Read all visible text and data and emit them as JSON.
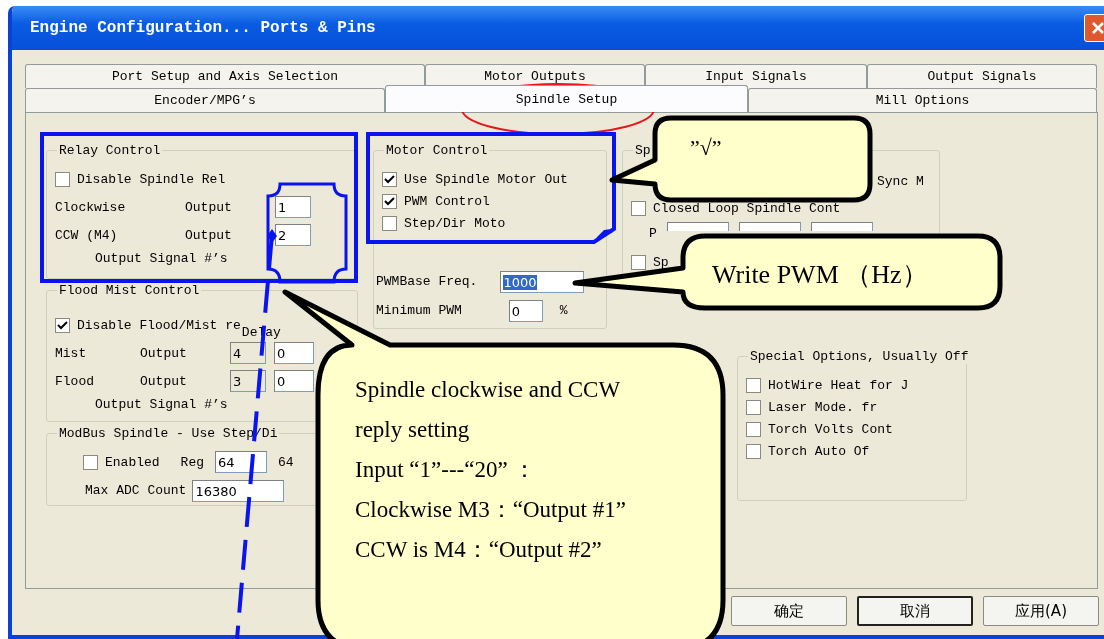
{
  "window": {
    "title": "Engine Configuration... Ports & Pins"
  },
  "tab_rows": [
    [
      {
        "label": "Port Setup and Axis Selection",
        "selected": false
      },
      {
        "label": "Motor Outputs",
        "selected": false
      },
      {
        "label": "Input Signals",
        "selected": false
      },
      {
        "label": "Output Signals",
        "selected": false
      }
    ],
    [
      {
        "label": "Encoder/MPG’s",
        "selected": false
      },
      {
        "label": "Spindle Setup",
        "selected": true
      },
      {
        "label": "Mill Options",
        "selected": false
      }
    ]
  ],
  "relay_control": {
    "title": "Relay Control",
    "disable": {
      "label": "Disable Spindle Rel",
      "checked": false
    },
    "outputs": [
      {
        "name": "Clockwise",
        "label": "Output",
        "value": "1"
      },
      {
        "name": "CCW (M4)",
        "label": "Output",
        "value": "2"
      }
    ],
    "footer": "Output Signal #’s"
  },
  "flood_mist_control": {
    "title": "Flood Mist Control",
    "disable": {
      "label": "Disable Flood/Mist re",
      "checked": true
    },
    "delay_label": "Delay",
    "outputs": [
      {
        "name": "Mist",
        "label": "Output",
        "value": "4",
        "delay": "0"
      },
      {
        "name": "Flood",
        "label": "Output",
        "value": "3",
        "delay": "0"
      }
    ],
    "footer": "Output Signal #’s"
  },
  "modbus_spindle": {
    "title": "ModBus Spindle - Use Step/Di",
    "enabled": {
      "label": "Enabled",
      "checked": false
    },
    "reg_label": "Reg",
    "reg_value": "64",
    "reg_text": "64",
    "max_adc_label": "Max ADC Count",
    "max_adc_value": "16380"
  },
  "motor_control": {
    "title": "Motor Control",
    "options": [
      {
        "label": "Use Spindle Motor Out",
        "checked": true
      },
      {
        "label": "PWM Control",
        "checked": true
      },
      {
        "label": "Step/Dir Moto",
        "checked": false
      }
    ],
    "pwm_base_label": "PWMBase Freq.",
    "pwm_base_value": "1000",
    "pwm_base_highlighted": true,
    "min_pwm_label": "Minimum PWM",
    "min_pwm_value": "0",
    "min_pwm_unit": "%"
  },
  "spindle_group": {
    "title": "Sp",
    "sync_label": "Sync M",
    "closed_loop": {
      "label": "Closed Loop Spindle Cont",
      "checked": false
    },
    "p_label": "P",
    "speed": {
      "label": "Sp",
      "checked": false
    }
  },
  "special_options": {
    "title": "Special Options, Usually Off",
    "options": [
      {
        "label": "HotWire Heat for J",
        "checked": false
      },
      {
        "label": "Laser Mode. fr",
        "checked": false
      },
      {
        "label": "Torch Volts Cont",
        "checked": false
      },
      {
        "label": "Torch Auto Of",
        "checked": false
      }
    ]
  },
  "buttons": [
    {
      "label": "确定",
      "default": false
    },
    {
      "label": "取消",
      "default": true
    },
    {
      "label": "应用(A)",
      "default": false
    }
  ],
  "callouts": [
    {
      "lines": [
        "”√”"
      ]
    },
    {
      "lines": [
        "Write PWM （Hz）"
      ]
    },
    {
      "lines": [
        "Spindle clockwise and CCW",
        "reply setting",
        "Input “1”---“20” ：",
        "Clockwise M3：“Output #1”",
        "CCW is M4：“Output #2”"
      ]
    }
  ]
}
